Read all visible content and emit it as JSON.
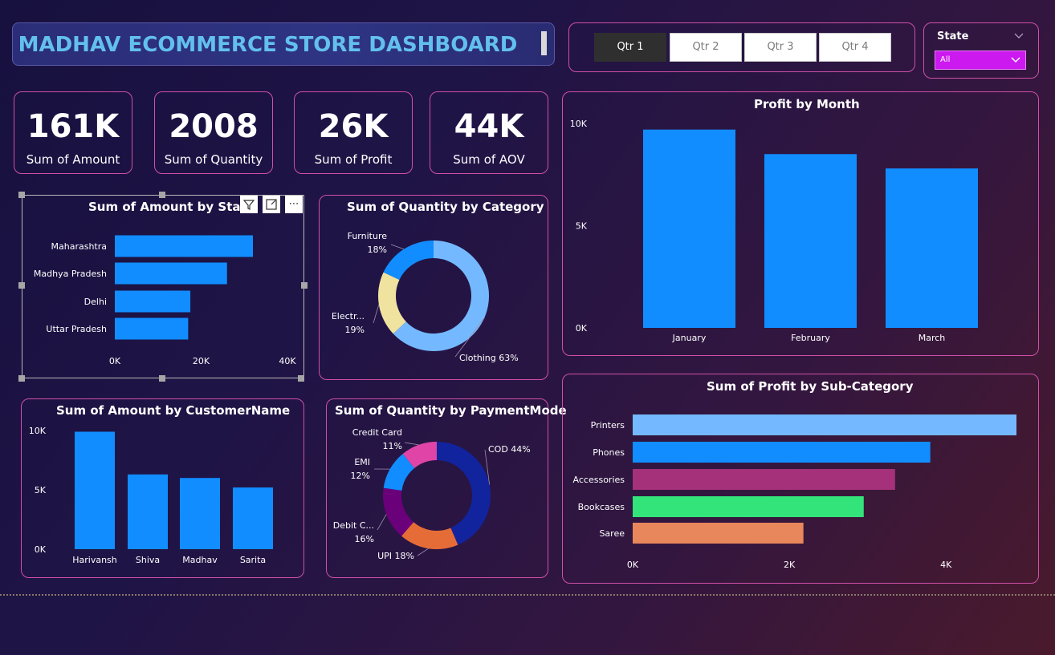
{
  "title": "MADHAV ECOMMERCE STORE DASHBOARD",
  "quarters": [
    "Qtr 1",
    "Qtr 2",
    "Qtr 3",
    "Qtr 4"
  ],
  "active_quarter": "Qtr 1",
  "state_filter": {
    "label": "State",
    "selected": "All"
  },
  "kpis": [
    {
      "value": "161K",
      "label": "Sum of Amount"
    },
    {
      "value": "2008",
      "label": "Sum of Quantity"
    },
    {
      "value": "26K",
      "label": "Sum of Profit"
    },
    {
      "value": "44K",
      "label": "Sum of AOV"
    }
  ],
  "chart_data": [
    {
      "id": "amount_by_state",
      "type": "bar",
      "orientation": "horizontal",
      "title": "Sum of Amount by State",
      "categories": [
        "Maharashtra",
        "Madhya Pradesh",
        "Delhi",
        "Uttar Pradesh"
      ],
      "values": [
        32000,
        26000,
        17500,
        17000
      ],
      "xlim": [
        0,
        40000
      ],
      "ticks": [
        "0K",
        "20K",
        "40K"
      ],
      "color": "#118dff"
    },
    {
      "id": "quantity_by_category",
      "type": "pie",
      "donut": true,
      "title": "Sum of Quantity by Category",
      "slices": [
        {
          "label": "Clothing",
          "pct": "63%",
          "value": 63,
          "color": "#74b9ff"
        },
        {
          "label": "Electr...",
          "pct": "19%",
          "value": 19,
          "color": "#f0e3a0"
        },
        {
          "label": "Furniture",
          "pct": "18%",
          "value": 18,
          "color": "#118dff"
        }
      ]
    },
    {
      "id": "profit_by_month",
      "type": "bar",
      "title": "Profit by Month",
      "categories": [
        "January",
        "February",
        "March"
      ],
      "values": [
        9700,
        8500,
        7800
      ],
      "ylim": [
        0,
        10000
      ],
      "ticks": [
        "0K",
        "5K",
        "10K"
      ],
      "color": "#118dff"
    },
    {
      "id": "amount_by_customer",
      "type": "bar",
      "title": "Sum of Amount by CustomerName",
      "categories": [
        "Harivansh",
        "Shiva",
        "Madhav",
        "Sarita"
      ],
      "values": [
        9900,
        6300,
        6000,
        5200
      ],
      "ylim": [
        0,
        10000
      ],
      "ticks": [
        "0K",
        "5K",
        "10K"
      ],
      "color": "#118dff"
    },
    {
      "id": "quantity_by_payment",
      "type": "pie",
      "donut": true,
      "title": "Sum of Quantity by PaymentMode",
      "slices": [
        {
          "label": "COD",
          "pct": "44%",
          "value": 44,
          "color": "#12239e"
        },
        {
          "label": "UPI",
          "pct": "18%",
          "value": 18,
          "color": "#e66c37"
        },
        {
          "label": "Debit C...",
          "pct": "16%",
          "value": 16,
          "color": "#6b007b"
        },
        {
          "label": "EMI",
          "pct": "12%",
          "value": 12,
          "color": "#118dff"
        },
        {
          "label": "Credit Card",
          "pct": "11%",
          "value": 11,
          "color": "#e044a7"
        }
      ]
    },
    {
      "id": "profit_by_subcategory",
      "type": "bar",
      "orientation": "horizontal",
      "title": "Sum of Profit by Sub-Category",
      "categories": [
        "Printers",
        "Phones",
        "Accessories",
        "Bookcases",
        "Saree"
      ],
      "values": [
        4900,
        3800,
        3350,
        2950,
        2180
      ],
      "colors": [
        "#74b9ff",
        "#118dff",
        "#a4317a",
        "#32e47a",
        "#e8875c"
      ],
      "xlim": [
        0,
        4900
      ],
      "ticks": [
        "0K",
        "2K",
        "4K"
      ],
      "tick_values": [
        0,
        2000,
        4000
      ]
    }
  ]
}
